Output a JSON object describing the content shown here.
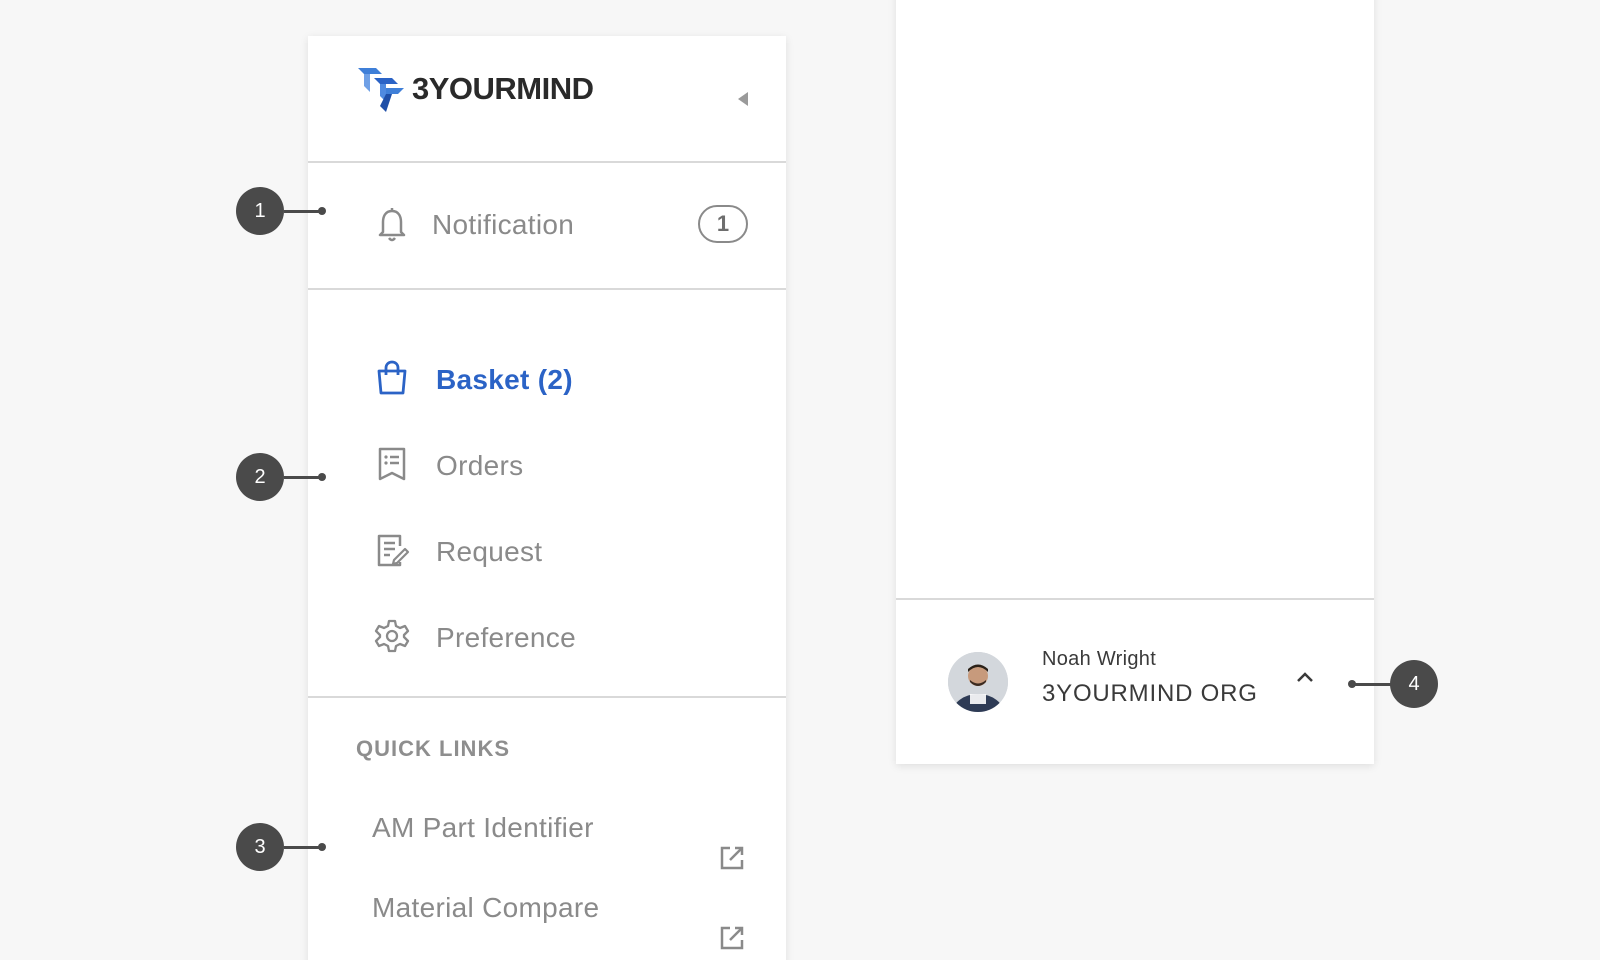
{
  "brand": {
    "name": "3YOURMIND",
    "mark_color": "#3f7fd8"
  },
  "notification": {
    "label": "Notification",
    "count": "1"
  },
  "nav": {
    "items": [
      {
        "label": "Basket (2)",
        "icon": "basket-icon",
        "active": true
      },
      {
        "label": "Orders",
        "icon": "orders-icon",
        "active": false
      },
      {
        "label": "Request",
        "icon": "request-icon",
        "active": false
      },
      {
        "label": "Preference",
        "icon": "gear-icon",
        "active": false
      }
    ],
    "active_color": "#2b63c6"
  },
  "quick_links": {
    "title": "QUICK LINKS",
    "items": [
      {
        "label": "AM Part Identifier",
        "icon": "external-link-icon"
      },
      {
        "label": "Material Compare",
        "icon": "external-link-icon"
      }
    ]
  },
  "user": {
    "name": "Noah Wright",
    "org": "3YOURMIND ORG"
  },
  "markers": [
    "1",
    "2",
    "3",
    "4"
  ]
}
